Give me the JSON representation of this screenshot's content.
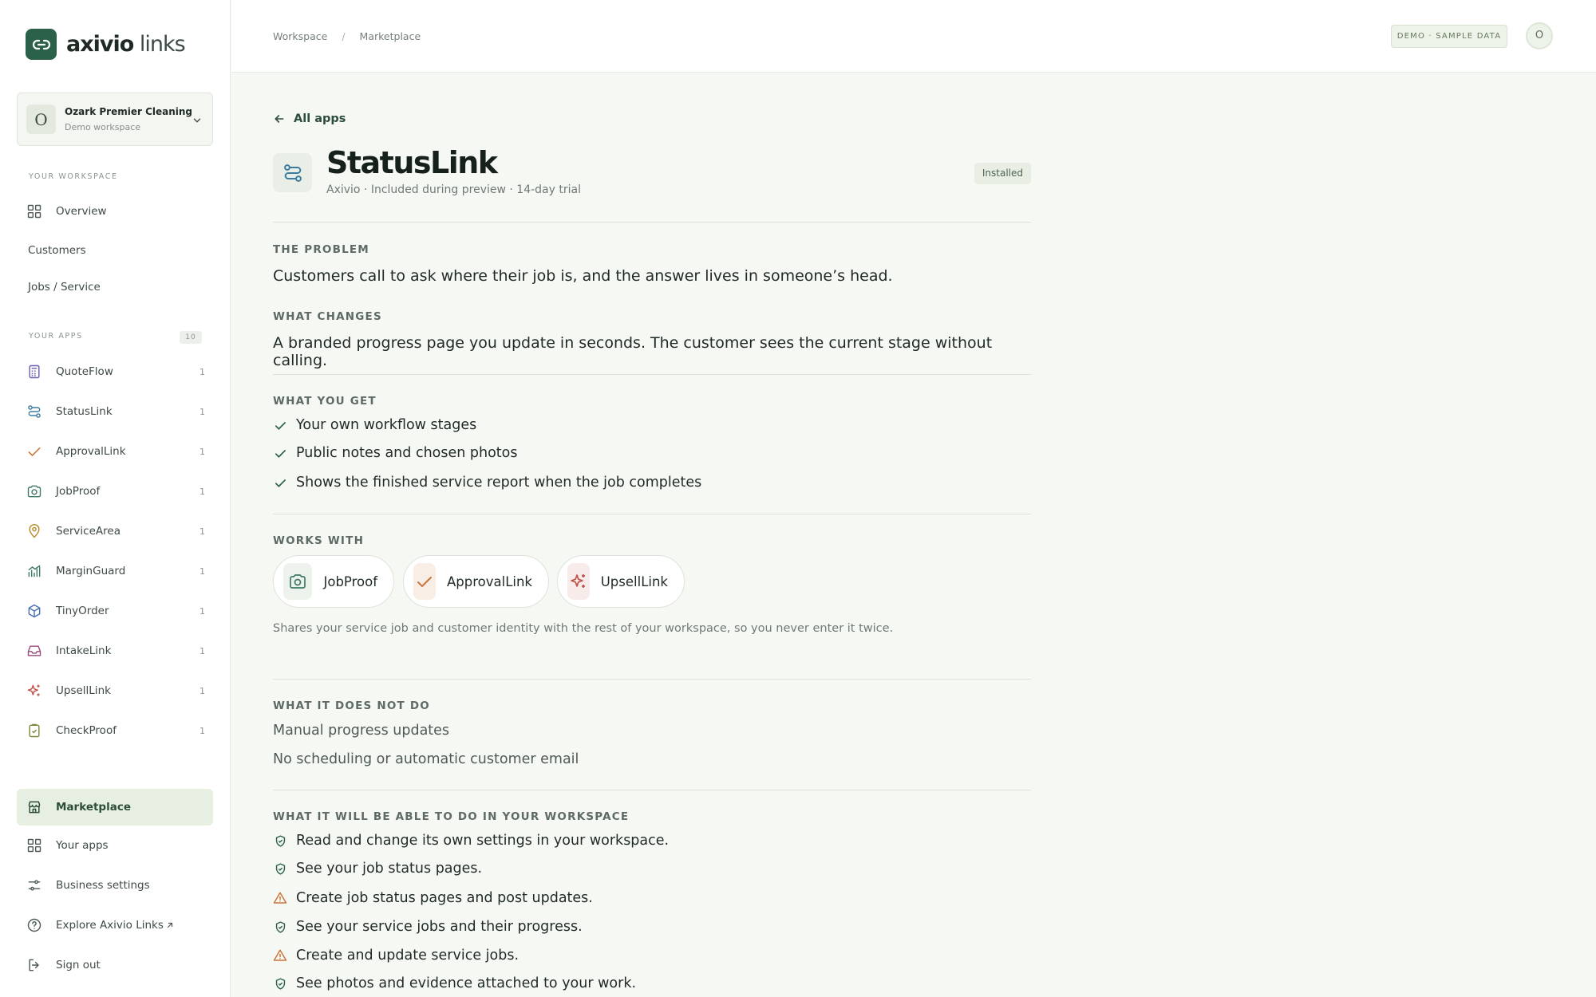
{
  "brand": {
    "name_bold": "axivio",
    "name_light": "links"
  },
  "workspace": {
    "initial": "O",
    "name": "Ozark Premier Cleaning",
    "sub": "Demo workspace"
  },
  "sidebar": {
    "your_workspace_label": "YOUR WORKSPACE",
    "workspace_items": [
      {
        "label": "Overview",
        "icon": "grid-icon"
      },
      {
        "label": "Customers"
      },
      {
        "label": "Jobs / Service"
      }
    ],
    "your_apps_label": "YOUR APPS",
    "apps_count": "10",
    "apps": [
      {
        "label": "QuoteFlow",
        "count": "1",
        "icon": "calculator-icon",
        "color": "#6a5fb0"
      },
      {
        "label": "StatusLink",
        "count": "1",
        "icon": "route-icon",
        "color": "#3a7ca0"
      },
      {
        "label": "ApprovalLink",
        "count": "1",
        "icon": "check-icon",
        "color": "#c9753a"
      },
      {
        "label": "JobProof",
        "count": "1",
        "icon": "camera-icon",
        "color": "#3f7a66"
      },
      {
        "label": "ServiceArea",
        "count": "1",
        "icon": "map-pin-icon",
        "color": "#b98a2a"
      },
      {
        "label": "MarginGuard",
        "count": "1",
        "icon": "chart-icon",
        "color": "#3f7a66"
      },
      {
        "label": "TinyOrder",
        "count": "1",
        "icon": "box-icon",
        "color": "#4a6fb0"
      },
      {
        "label": "IntakeLink",
        "count": "1",
        "icon": "inbox-icon",
        "color": "#9a4a7a"
      },
      {
        "label": "UpsellLink",
        "count": "1",
        "icon": "sparkle-icon",
        "color": "#c0524a"
      },
      {
        "label": "CheckProof",
        "count": "1",
        "icon": "clipboard-check-icon",
        "color": "#7a8a3a"
      }
    ],
    "bottom": [
      {
        "label": "Marketplace",
        "icon": "store-icon"
      },
      {
        "label": "Your apps",
        "icon": "grid-icon"
      },
      {
        "label": "Business settings",
        "icon": "sliders-icon"
      },
      {
        "label": "Explore Axivio Links",
        "icon": "help-icon"
      },
      {
        "label": "Sign out",
        "icon": "logout-icon"
      }
    ]
  },
  "topbar": {
    "breadcrumb": [
      "Workspace",
      "/",
      "Marketplace"
    ],
    "demo_badge": "DEMO · SAMPLE DATA",
    "user_initial": "O"
  },
  "app": {
    "back_label": "All apps",
    "title": "StatusLink",
    "meta": "Axivio · Included during preview · 14-day trial",
    "status": "Installed",
    "problem_heading": "THE PROBLEM",
    "problem": "Customers call to ask where their job is, and the answer lives in someone’s head.",
    "changes_heading": "WHAT CHANGES",
    "changes": "A branded progress page you update in seconds. The customer sees the current stage without calling.",
    "get_heading": "WHAT YOU GET",
    "get": [
      "Your own workflow stages",
      "Public notes and chosen photos",
      "Shows the finished service report when the job completes"
    ],
    "works_heading": "WORKS WITH",
    "works_with": [
      {
        "label": "JobProof",
        "icon": "camera-icon"
      },
      {
        "label": "ApprovalLink",
        "icon": "check-icon"
      },
      {
        "label": "UpsellLink",
        "icon": "sparkle-icon"
      }
    ],
    "works_note": "Shares your service job and customer identity with the rest of your workspace, so you never enter it twice.",
    "not_heading": "WHAT IT DOES NOT DO",
    "not_do": [
      "Manual progress updates",
      "No scheduling or automatic customer email"
    ],
    "perm_heading": "WHAT IT WILL BE ABLE TO DO IN YOUR WORKSPACE",
    "permissions": [
      {
        "text": "Read and change its own settings in your workspace.",
        "level": "safe"
      },
      {
        "text": "See your job status pages.",
        "level": "safe"
      },
      {
        "text": "Create job status pages and post updates.",
        "level": "warn"
      },
      {
        "text": "See your service jobs and their progress.",
        "level": "safe"
      },
      {
        "text": "Create and update service jobs.",
        "level": "warn"
      },
      {
        "text": "See photos and evidence attached to your work.",
        "level": "safe"
      }
    ]
  }
}
